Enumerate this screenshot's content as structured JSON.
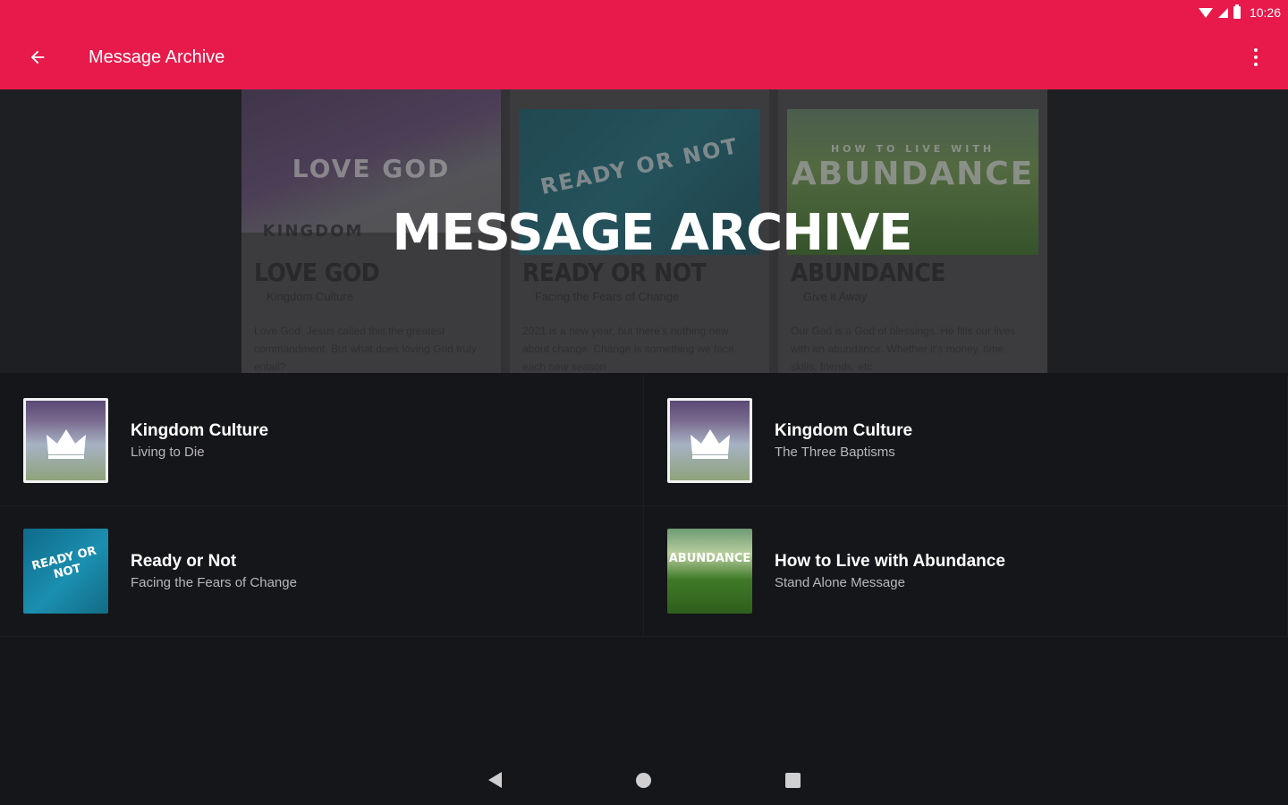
{
  "status_bar": {
    "time": "10:26"
  },
  "app_bar": {
    "title": "Message Archive"
  },
  "hero": {
    "title": "MESSAGE ARCHIVE",
    "cards": [
      {
        "image_text": "LOVE GOD",
        "image_subtext": "KINGDOM",
        "title": "LOVE GOD",
        "subtitle": "Kingdom Culture",
        "body": "Love God. Jesus called this the greatest commandment. But what does loving God truly entail?"
      },
      {
        "image_text": "READY OR NOT",
        "image_subtext": "",
        "title": "READY OR NOT",
        "subtitle": "Facing the Fears of Change",
        "body": "2021 is a new year, but there's nothing new about change. Change is something we face each new season"
      },
      {
        "image_text": "ABUNDANCE",
        "image_subtext": "HOW TO LIVE WITH",
        "title": "ABUNDANCE",
        "subtitle": "Give it Away",
        "body": "Our God is a God of blessings. He fills our lives with an abundance. Whether it's money, time, skills, friends, etc"
      }
    ]
  },
  "messages": [
    {
      "title": "Kingdom Culture",
      "subtitle": "Living to Die",
      "thumb": "kingdom",
      "thumb_icon": "crown-icon"
    },
    {
      "title": "Kingdom Culture",
      "subtitle": "The Three Baptisms",
      "thumb": "kingdom",
      "thumb_icon": "crown-icon"
    },
    {
      "title": "Ready or Not",
      "subtitle": "Facing the Fears of Change",
      "thumb": "ready",
      "thumb_label": "READY OR NOT"
    },
    {
      "title": "How to Live with Abundance",
      "subtitle": "Stand Alone Message",
      "thumb": "abundance",
      "thumb_label": "ABUNDANCE"
    }
  ],
  "colors": {
    "accent": "#e81a4b",
    "background": "#151619",
    "hero_background": "#1e1f22"
  }
}
